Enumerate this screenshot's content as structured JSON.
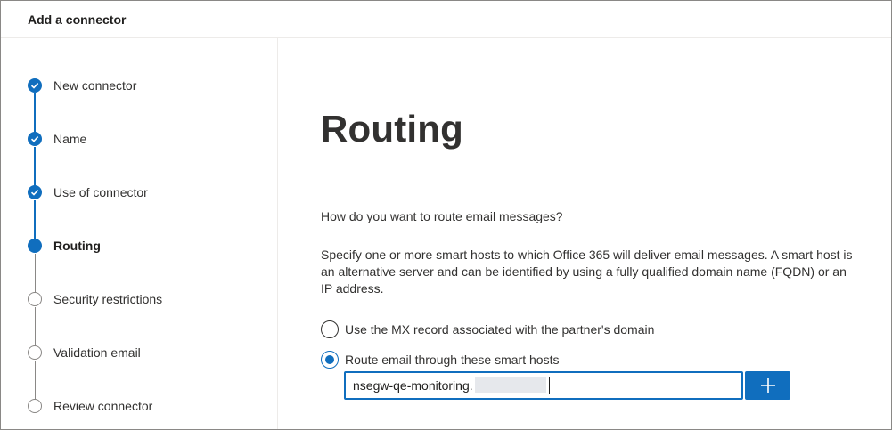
{
  "header": {
    "title": "Add a connector"
  },
  "steps": [
    {
      "label": "New connector",
      "state": "done"
    },
    {
      "label": "Name",
      "state": "done"
    },
    {
      "label": "Use of connector",
      "state": "done"
    },
    {
      "label": "Routing",
      "state": "current"
    },
    {
      "label": "Security restrictions",
      "state": "todo"
    },
    {
      "label": "Validation email",
      "state": "todo"
    },
    {
      "label": "Review connector",
      "state": "todo"
    }
  ],
  "main": {
    "title": "Routing",
    "question": "How do you want to route email messages?",
    "description": "Specify one or more smart hosts to which Office 365 will deliver email messages. A smart host is an alternative server and can be identified by using a fully qualified domain name (FQDN) or an IP address.",
    "options": [
      {
        "label": "Use the MX record associated with the partner's domain",
        "selected": false
      },
      {
        "label": "Route email through these smart hosts",
        "selected": true
      }
    ],
    "smart_host_value": "nsegw-qe-monitoring."
  },
  "colors": {
    "accent": "#106ebe",
    "inactive": "#8a8886"
  }
}
